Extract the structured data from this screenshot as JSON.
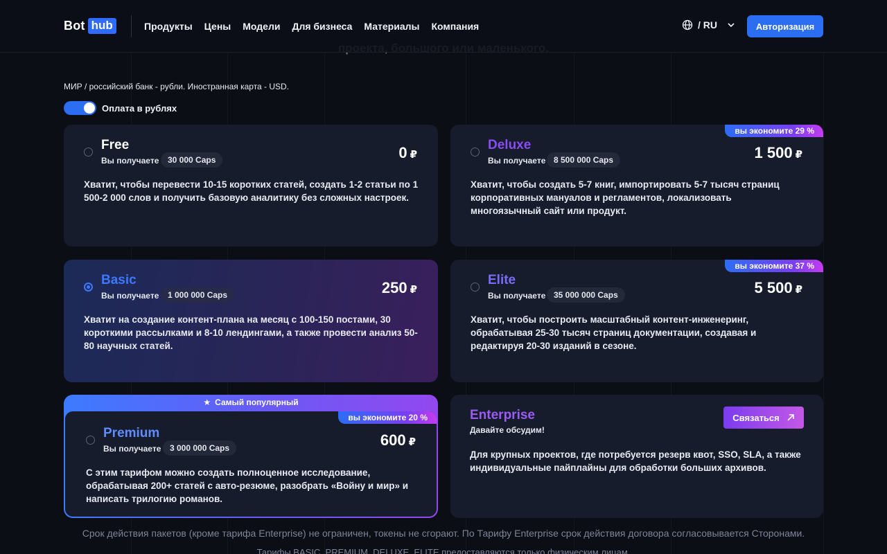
{
  "header": {
    "logo_bot": "Bot",
    "logo_hub": "hub",
    "nav": [
      "Продукты",
      "Цены",
      "Модели",
      "Для бизнеса",
      "Материалы",
      "Компания"
    ],
    "lang": "/ RU",
    "auth_button": "Авторизация"
  },
  "hero_ghost": {
    "line3": "проекта, большого или маленького."
  },
  "payment_note": "МИР / российский банк - рубли. Иностранная карта - USD.",
  "currency_toggle": {
    "label": "Оплата в рублях",
    "on": true
  },
  "you_get_label": "Вы получаете",
  "currency_symbol": "₽",
  "plans": {
    "free": {
      "name": "Free",
      "caps": "30 000 Caps",
      "price": "0",
      "desc": "Хватит, чтобы перевести 10-15 коротких статей, создать 1-2 статьи по 1 500-2 000 слов и получить базовую аналитику без сложных настроек."
    },
    "deluxe": {
      "name": "Deluxe",
      "caps": "8 500 000 Caps",
      "price": "1 500",
      "save": "вы экономите 29 %",
      "desc": "Хватит, чтобы создать 5-7 книг, импортировать 5-7 тысяч страниц корпоративных мануалов и регламентов, локализовать многоязычный сайт или продукт."
    },
    "basic": {
      "name": "Basic",
      "caps": "1 000 000 Caps",
      "price": "250",
      "desc": "Хватит на создание контент-плана на месяц с 100-150 постами, 30 короткими рассылками и 8-10 лендингами, а также провести анализ 50-80 научных статей."
    },
    "elite": {
      "name": "Elite",
      "caps": "35 000 000 Caps",
      "price": "5 500",
      "save": "вы экономите 37 %",
      "desc": "Хватит, чтобы построить масштабный контент-инженеринг, обрабатывая 25-30 тысяч страниц документации, создавая и редактируя 20-30 изданий в сезоне."
    },
    "premium": {
      "badge": "Самый популярный",
      "name": "Premium",
      "caps": "3 000 000 Caps",
      "price": "600",
      "save": "вы экономите 20 %",
      "desc": "С этим тарифом можно создать полноценное исследование, обрабатывая 200+ статей с авто-резюме, разобрать «Войну и мир» и написать трилогию романов."
    },
    "enterprise": {
      "name": "Enterprise",
      "subtitle": "Давайте обсудим!",
      "button": "Связаться",
      "desc": "Для крупных проектов, где потребуется резерв квот, SSO, SLA, а также индивидуальные пайплайны для обработки больших архивов."
    }
  },
  "footer": {
    "validity": "Срок действия пакетов (кроме тарифа Enterprise) не ограничен, токены не сгорают. По Тарифу Enterprise срок действия договора согласовывается Сторонами.",
    "individuals": "Тарифы BASIC, PREMIUM, DELUXE, ELITE предоставляются только физическим лицам."
  },
  "colors": {
    "accent": "#2b6ef2",
    "deluxe_name": "#8a4cf5",
    "basic_name": "#3d78ff",
    "elite_name": "#7b6cf8",
    "premium_name": "#5f8cff",
    "enterprise_name": "#9b5cf5"
  },
  "icons": [
    "globe-icon",
    "chevron-down-icon",
    "star-icon",
    "arrow-up-right-icon"
  ]
}
